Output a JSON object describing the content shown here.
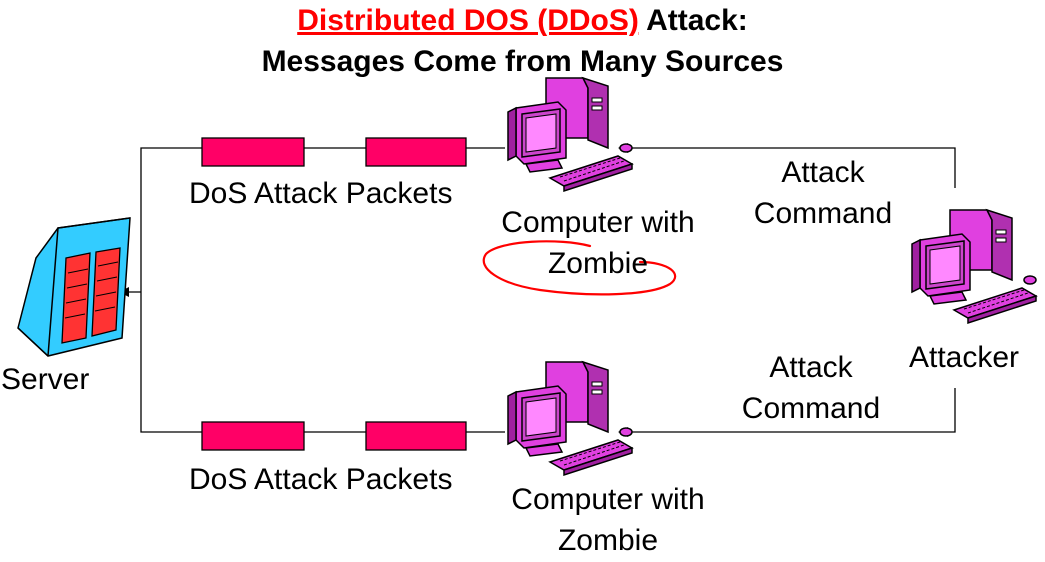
{
  "title": {
    "highlight": "Distributed DOS (DDoS)",
    "rest": " Attack:",
    "line2": "Messages Come from Many Sources"
  },
  "labels": {
    "server": "Server",
    "attacker": "Attacker",
    "packets_top": "DoS Attack Packets",
    "packets_bottom": "DoS Attack Packets",
    "zombie_top_line1": "Computer with",
    "zombie_top_line2": "Zombie",
    "zombie_bottom_line1": "Computer with",
    "zombie_bottom_line2": "Zombie",
    "command_top_line1": "Attack",
    "command_top_line2": "Command",
    "command_bottom_line1": "Attack",
    "command_bottom_line2": "Command"
  },
  "icons": {
    "server": "server-icon",
    "zombie": "computer-icon",
    "attacker": "computer-icon",
    "packet": "packet-block"
  },
  "colors": {
    "title_highlight": "#ff0000",
    "packet_fill": "#ff0066",
    "computer_fill": "#e040e0",
    "server_fill": "#33ccff",
    "server_panel": "#ff3333",
    "annotation_ink": "#ff0000",
    "line": "#000000"
  }
}
